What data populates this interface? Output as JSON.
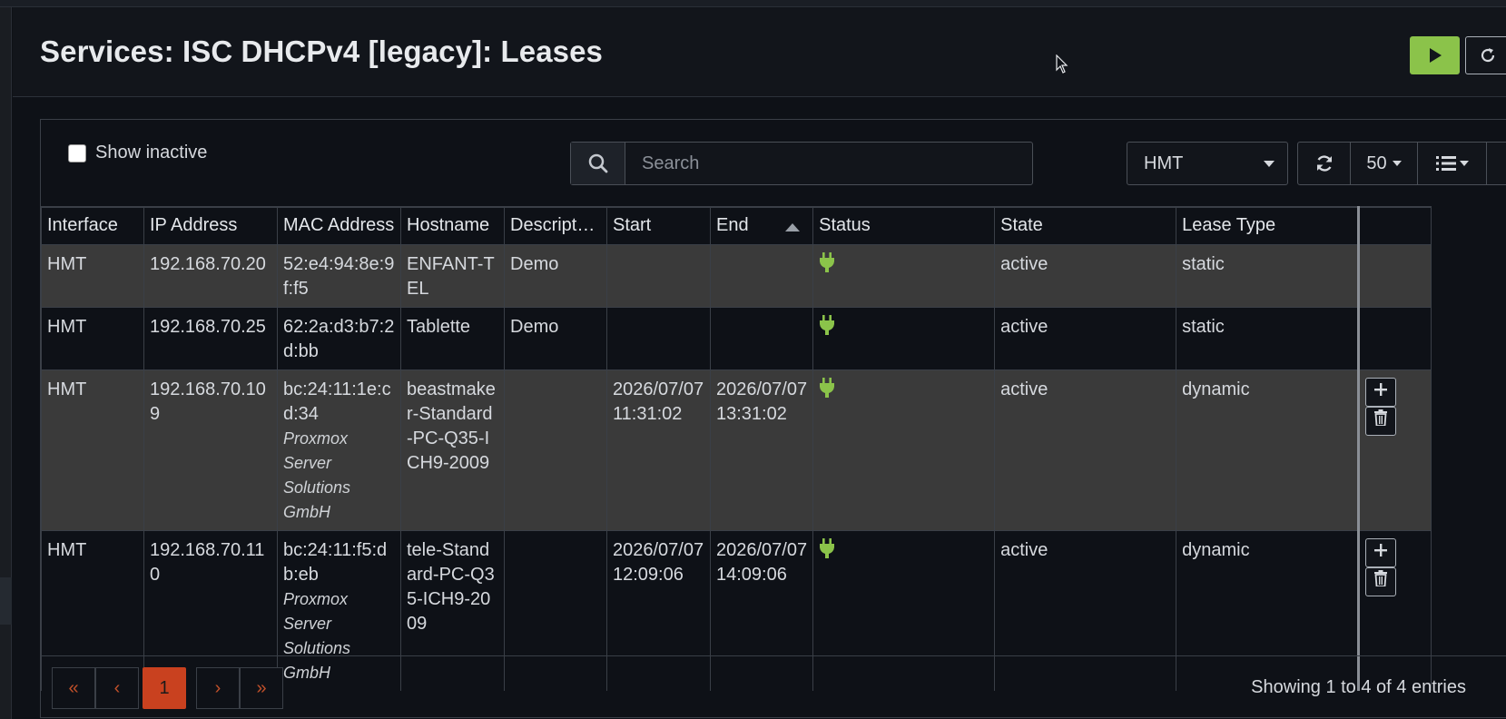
{
  "page": {
    "title": "Services: ISC DHCPv4 [legacy]: Leases"
  },
  "header_buttons": {
    "apply_icon": "play-icon",
    "reload_icon": "reload-icon"
  },
  "toolbar": {
    "show_inactive_label": "Show inactive",
    "search_placeholder": "Search",
    "search_value": "",
    "interface_selected": "HMT",
    "rows_per_page": "50",
    "icons": [
      "search-icon",
      "refresh-icon",
      "columns-icon"
    ]
  },
  "table": {
    "columns": [
      "Interface",
      "IP Address",
      "MAC Address",
      "Hostname",
      "Descript…",
      "Start",
      "End",
      "Status",
      "State",
      "Lease Type"
    ],
    "sort": {
      "column": "End",
      "direction": "asc"
    },
    "rows": [
      {
        "interface": "HMT",
        "ip": "192.168.70.20",
        "mac": "52:e4:94:8e:9f:f5",
        "vendor": "",
        "hostname": "ENFANT-TEL",
        "description": "Demo",
        "start": "",
        "end": "",
        "status_icon": "plug-icon",
        "state": "active",
        "lease_type": "static",
        "actions": false
      },
      {
        "interface": "HMT",
        "ip": "192.168.70.25",
        "mac": "62:2a:d3:b7:2d:bb",
        "vendor": "",
        "hostname": "Tablette",
        "description": "Demo",
        "start": "",
        "end": "",
        "status_icon": "plug-icon",
        "state": "active",
        "lease_type": "static",
        "actions": false
      },
      {
        "interface": "HMT",
        "ip": "192.168.70.109",
        "mac": "bc:24:11:1e:cd:34",
        "vendor": "Proxmox Server Solutions GmbH",
        "hostname": "beastmaker-Standard-PC-Q35-ICH9-2009",
        "description": "",
        "start": "2026/07/07 11:31:02",
        "end": "2026/07/07 13:31:02",
        "status_icon": "plug-icon",
        "state": "active",
        "lease_type": "dynamic",
        "actions": true
      },
      {
        "interface": "HMT",
        "ip": "192.168.70.110",
        "mac": "bc:24:11:f5:db:eb",
        "vendor": "Proxmox Server Solutions GmbH",
        "hostname": "tele-Standard-PC-Q35-ICH9-2009",
        "description": "",
        "start": "2026/07/07 12:09:06",
        "end": "2026/07/07 14:09:06",
        "status_icon": "plug-icon",
        "state": "active",
        "lease_type": "dynamic",
        "actions": true
      }
    ]
  },
  "pagination": {
    "first": "«",
    "prev": "‹",
    "current": "1",
    "next": "›",
    "last": "»",
    "info": "Showing 1 to 4 of 4 entries"
  },
  "colors": {
    "accent": "#8bc34a",
    "pager_active": "#c9411f",
    "status_plug": "#8bc34a"
  }
}
